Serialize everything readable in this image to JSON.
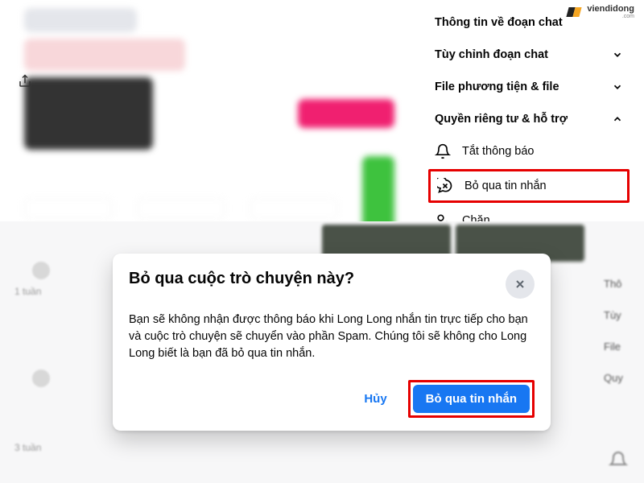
{
  "watermark": {
    "text": "viendidong",
    "sub": ".com"
  },
  "panel": {
    "rows": [
      {
        "label": "Thông tin về đoạn chat",
        "expanded": false
      },
      {
        "label": "Tùy chỉnh đoạn chat",
        "expanded": false
      },
      {
        "label": "File phương tiện & file",
        "expanded": false
      },
      {
        "label": "Quyền riêng tư & hỗ trợ",
        "expanded": true
      }
    ],
    "subitems": {
      "mute": "Tắt thông báo",
      "ignore": "Bỏ qua tin nhắn",
      "block": "Chặn"
    }
  },
  "bg": {
    "time1": "1 tuần",
    "time2": "3 tuần",
    "right": [
      "Thô",
      "Tùy",
      "File",
      "Quy"
    ]
  },
  "dialog": {
    "title": "Bỏ qua cuộc trò chuyện này?",
    "body": "Bạn sẽ không nhận được thông báo khi Long Long nhắn tin trực tiếp cho bạn và cuộc trò chuyện sẽ chuyển vào phần Spam. Chúng tôi sẽ không cho Long Long biết là bạn đã bỏ qua tin nhắn.",
    "cancel": "Hủy",
    "confirm": "Bỏ qua tin nhắn"
  }
}
